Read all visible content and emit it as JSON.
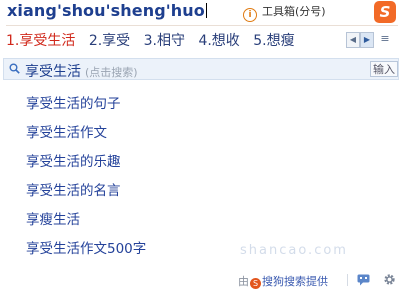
{
  "composition": {
    "pinyin": "xiang'shou'sheng'huo"
  },
  "toolbox": {
    "label": "工具箱(分号)"
  },
  "logo": {
    "glyph": "S"
  },
  "candidates": [
    {
      "label": "1.享受生活"
    },
    {
      "label": "2.享受"
    },
    {
      "label": "3.相守"
    },
    {
      "label": "4.想收"
    },
    {
      "label": "5.想瘦"
    }
  ],
  "pager": {
    "prev": "◀",
    "next": "▶",
    "menu": "≡"
  },
  "search": {
    "query": "享受生活",
    "hint": "(点击搜索)",
    "input_button": "输入"
  },
  "suggestions": [
    "享受生活的句子",
    "享受生活作文",
    "享受生活的乐趣",
    "享受生活的名言",
    "享瘦生活",
    "享受生活作文500字"
  ],
  "watermark": "shancao.com",
  "footer": {
    "prefix": "由",
    "brand": "搜狗搜索提供"
  },
  "colors": {
    "composition": "#1e3f8f",
    "first_candidate": "#d0281b",
    "candidates": "#2a3f7a",
    "suggestion": "#24429a",
    "accent_orange": "#f26a27",
    "search_bar_bg": "#ecf2fa"
  }
}
